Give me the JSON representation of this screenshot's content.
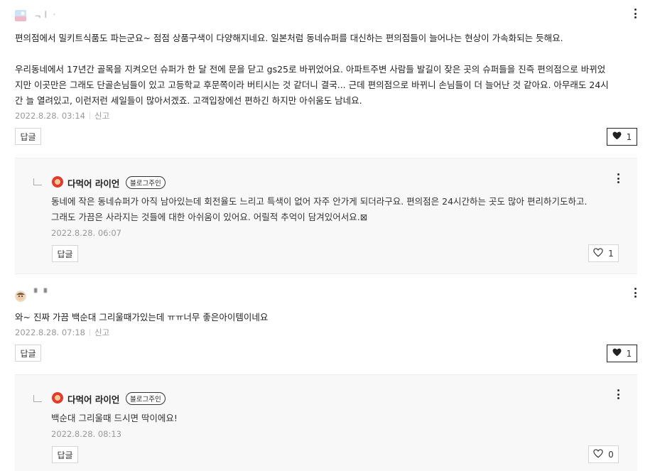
{
  "comments": [
    {
      "nickname": "ᆨㅣ ·",
      "lines": [
        "편의점에서 밀키트식품도 파는군요~ 점점 상품구색이 다양해지네요. 일본처럼 동네슈퍼를 대신하는 편의점들이 늘어나는 현상이 가속화되는 듯해요.",
        "",
        "우리동네에서 17년간 골목을 지켜오던 슈퍼가 한 달 전에 문을 닫고 gs25로 바뀌었어요. 아파트주변 사람들 발길이 잦은 곳의 슈퍼들을 진즉 편의점으로 바뀌었",
        "지만 이곳만은 그래도 단골손님들이 있고 고등학교 후문쪽이라 버티시는 것 같더니 결국... 근데 편의점으로 바뀌니 손님들이 더 늘어난 것 같아요. 아무래도 24시",
        "간 늘 열려있고, 이런저런 세일들이 많아서겠죠. 고객입장에선 편하긴 하지만 아쉬움도 남네요."
      ],
      "date": "2022.8.28. 03:14",
      "report": "신고",
      "reply_label": "답글",
      "likes": "1",
      "reply": {
        "author": "다먹어 라이언",
        "badge": "블로그주인",
        "lines": [
          "동네에 작은 동네슈퍼가 아직 남아있는데 회전율도 느리고 특색이 없어 자주 안가게 되더라구요. 편의점은 24시간하는 곳도 많아 편리하기도하고.",
          "그래도 가끔은 사라지는 것들에 대한 아쉬움이 있어요. 어릴적 추억이 담겨있어서요.⊠"
        ],
        "date": "2022.8.28. 06:07",
        "reply_label": "답글",
        "likes": "1"
      }
    },
    {
      "nickname": "▘▝",
      "lines": [
        "와~ 진짜 가끔 백순대 그리울때가있는데 ㅠㅠ너무 좋은아이템이네요"
      ],
      "date": "2022.8.28. 07:18",
      "report": "신고",
      "reply_label": "답글",
      "likes": "1",
      "reply": {
        "author": "다먹어 라이언",
        "badge": "블로그주인",
        "lines": [
          "백순대 그리울때 드시면 딱이에요!"
        ],
        "date": "2022.8.28. 08:13",
        "reply_label": "답글",
        "likes": "0"
      }
    }
  ],
  "colors": {
    "text": "#222222",
    "meta": "#999999",
    "reply_bg": "#f8f8f8",
    "border": "#d6d6d6",
    "heart": "#222222"
  },
  "icons": [
    "more-vertical-icon",
    "heart-filled-icon",
    "heart-outline-icon",
    "reply-corner-icon",
    "lion-avatar-icon"
  ]
}
